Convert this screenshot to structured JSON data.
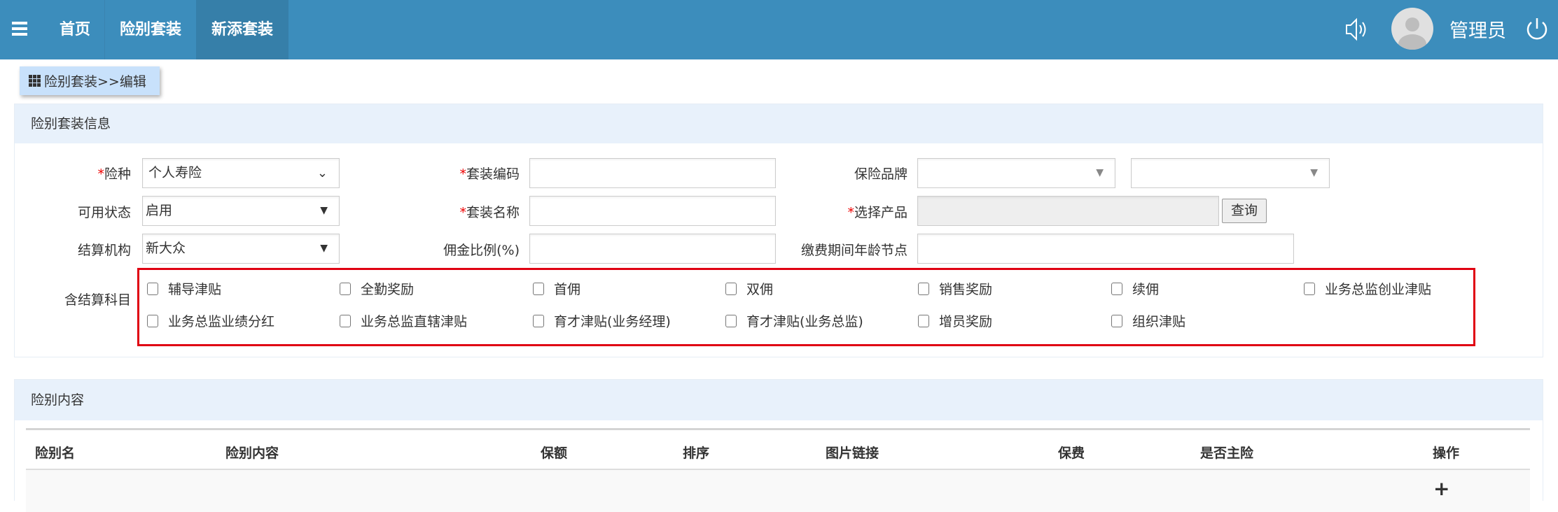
{
  "header": {
    "nav": [
      "首页",
      "险别套装",
      "新添套装"
    ],
    "active_index": 2,
    "username": "管理员",
    "color": "#3c8dbc"
  },
  "breadcrumb": "险别套装>>编辑",
  "info_panel": {
    "title": "险别套装信息",
    "fields": {
      "risk_type": {
        "label": "险种",
        "required": "*",
        "value": "个人寿险"
      },
      "status": {
        "label": "可用状态",
        "value": "启用"
      },
      "org": {
        "label": "结算机构",
        "value": "新大众"
      },
      "code": {
        "label": "套装编码",
        "required": "*",
        "value": ""
      },
      "name": {
        "label": "套装名称",
        "required": "*",
        "value": ""
      },
      "commission": {
        "label": "佣金比例(%)",
        "value": ""
      },
      "brand": {
        "label": "保险品牌",
        "value": "",
        "value2": ""
      },
      "product": {
        "label": "选择产品",
        "required": "*",
        "value": "",
        "button": "查询"
      },
      "age_node": {
        "label": "缴费期间年龄节点",
        "value": ""
      }
    },
    "subjects_label": "含结算科目",
    "subjects": [
      "辅导津贴",
      "全勤奖励",
      "首佣",
      "双佣",
      "销售奖励",
      "续佣",
      "业务总监创业津贴",
      "业务总监业绩分红",
      "业务总监直辖津贴",
      "育才津贴(业务经理)",
      "育才津贴(业务总监)",
      "增员奖励",
      "组织津贴"
    ]
  },
  "content_panel": {
    "title": "险别内容",
    "columns": [
      "险别名",
      "险别内容",
      "保额",
      "排序",
      "图片链接",
      "保费",
      "是否主险",
      "操作"
    ],
    "add_icon": "+"
  }
}
